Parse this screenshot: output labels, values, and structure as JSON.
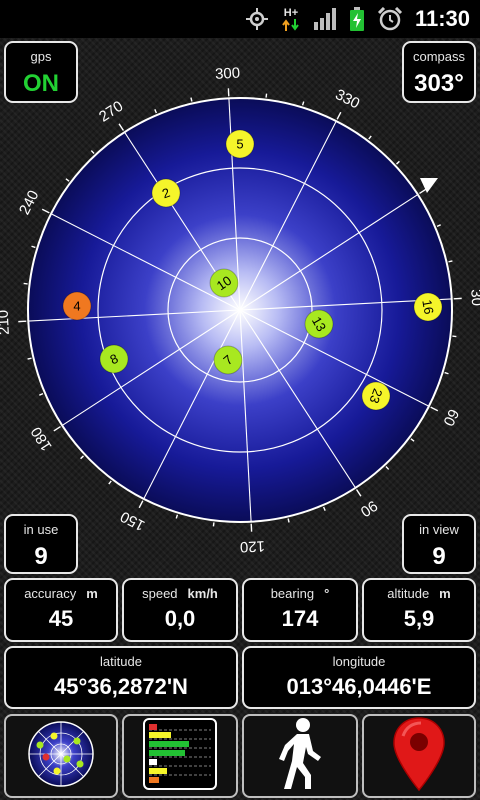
{
  "status_bar": {
    "time": "11:30",
    "network_label": "H+",
    "icons": [
      "gps-icon",
      "network-arrows-icon",
      "signal-bars-icon",
      "battery-charging-icon",
      "alarm-clock-icon"
    ]
  },
  "gps": {
    "label": "gps",
    "value": "ON"
  },
  "compass": {
    "label": "compass",
    "value": "303°"
  },
  "radar": {
    "degree_labels": [
      "300",
      "330",
      "30",
      "60",
      "90",
      "120",
      "150",
      "180",
      "210",
      "240",
      "270"
    ],
    "satellites": [
      {
        "id": "5",
        "color": "#f5f52a"
      },
      {
        "id": "2",
        "color": "#f5f52a"
      },
      {
        "id": "10",
        "color": "#a8e820"
      },
      {
        "id": "4",
        "color": "#f07820"
      },
      {
        "id": "8",
        "color": "#a8e820"
      },
      {
        "id": "7",
        "color": "#a8e820"
      },
      {
        "id": "13",
        "color": "#a8e820"
      },
      {
        "id": "16",
        "color": "#f5f52a"
      },
      {
        "id": "23",
        "color": "#f5f52a"
      }
    ]
  },
  "in_use": {
    "label": "in use",
    "value": "9"
  },
  "in_view": {
    "label": "in view",
    "value": "9"
  },
  "accuracy": {
    "label": "accuracy",
    "unit": "m",
    "value": "45"
  },
  "speed": {
    "label": "speed",
    "unit": "km/h",
    "value": "0,0"
  },
  "bearing": {
    "label": "bearing",
    "unit": "°",
    "value": "174"
  },
  "altitude": {
    "label": "altitude",
    "unit": "m",
    "value": "5,9"
  },
  "latitude": {
    "label": "latitude",
    "value": "45°36,2872'N"
  },
  "longitude": {
    "label": "longitude",
    "value": "013°46,0446'E"
  },
  "buttons": {
    "radar": "radar-view-icon",
    "signal": "signal-bars-chart-icon",
    "walk": "walking-person-icon",
    "map": "map-pin-icon"
  },
  "colors": {
    "accent_green": "#22d133",
    "sky_blue": "#14168a",
    "map_pin_red": "#e01818"
  }
}
